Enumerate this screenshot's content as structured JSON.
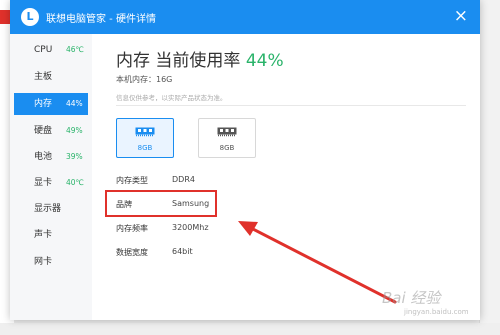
{
  "window": {
    "logo_letter": "L",
    "title": "联想电脑管家 - 硬件详情",
    "close_symbol": "×"
  },
  "sidebar": {
    "items": [
      {
        "label": "CPU",
        "value": "46℃"
      },
      {
        "label": "主板",
        "value": ""
      },
      {
        "label": "内存",
        "value": "44%"
      },
      {
        "label": "硬盘",
        "value": "49%"
      },
      {
        "label": "电池",
        "value": "39%"
      },
      {
        "label": "显卡",
        "value": "40℃"
      },
      {
        "label": "显示器",
        "value": ""
      },
      {
        "label": "声卡",
        "value": ""
      },
      {
        "label": "网卡",
        "value": ""
      }
    ],
    "active_index": 2
  },
  "main": {
    "heading": "内存 当前使用率 ",
    "usage_percent": "44%",
    "memory_info": "本机内存：16G",
    "note": "信息仅供参考，以实际产品状态为准。",
    "slots": [
      {
        "label": "8GB",
        "active": true
      },
      {
        "label": "8GB",
        "active": false
      }
    ],
    "properties": [
      {
        "label": "内存类型",
        "value": "DDR4"
      },
      {
        "label": "品牌",
        "value": "Samsung"
      },
      {
        "label": "内存频率",
        "value": "3200Mhz"
      },
      {
        "label": "数据宽度",
        "value": "64bit"
      }
    ]
  },
  "watermark": {
    "text": "Bai 经验",
    "url": "jingyan.baidu.com"
  },
  "colors": {
    "accent": "#1a8df0",
    "green": "#2ab36a",
    "annotation_red": "#e0312b"
  }
}
